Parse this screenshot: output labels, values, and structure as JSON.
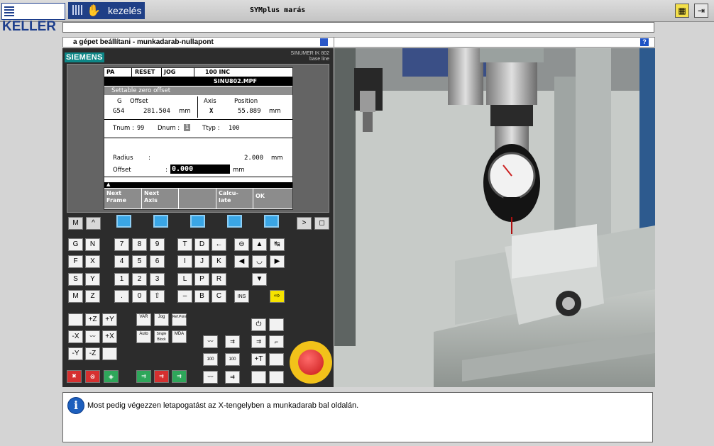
{
  "app": {
    "logo": "KELLER",
    "mode_label": "kezelés",
    "title": "SYMplus marás",
    "right_buttons": [
      "tool-icon",
      "exit-icon"
    ]
  },
  "panel_header": {
    "title": "a gépet beállítani - munkadarab-nullapont",
    "help": "?"
  },
  "controller": {
    "brand": "SIEMENS",
    "model_line1": "SINUMER IK 802",
    "model_line2": "base line",
    "status": {
      "mode": "PA",
      "reset": "RESET",
      "jog": "JOG",
      "inc": "100 INC"
    },
    "program": "SINU802.MPF",
    "section": "Settable zero offset",
    "offset": {
      "g_label": "G",
      "offset_label": "Offset",
      "g_value": "G54",
      "offset_value": "281.504",
      "offset_unit": "mm"
    },
    "axis": {
      "axis_label": "Axis",
      "position_label": "Position",
      "axis_value": "X",
      "position_value": "55.889",
      "position_unit": "mm"
    },
    "tool": {
      "tnum_label": "Tnum :",
      "tnum_value": "99",
      "dnum_label": "Dnum :",
      "dnum_value": "1",
      "ttyp_label": "Ttyp  :",
      "ttyp_value": "100"
    },
    "radius": {
      "label": "Radius",
      "colon": ":",
      "value": "2.000",
      "unit": "mm"
    },
    "offset_input": {
      "label": "Offset",
      "colon": ":",
      "value": "0.000",
      "unit": "mm"
    },
    "arrow": "▲",
    "softkeys": [
      {
        "line1": "Next",
        "line2": "Frame"
      },
      {
        "line1": "Next",
        "line2": "Axis"
      },
      {
        "line1": "",
        "line2": ""
      },
      {
        "line1": "Calcu-",
        "line2": "late"
      },
      {
        "line1": "OK",
        "line2": ""
      }
    ],
    "keys": {
      "row0": [
        "M",
        "^",
        ">",
        "◻"
      ],
      "letters": [
        [
          "G",
          "N"
        ],
        [
          "F",
          "X"
        ],
        [
          "S",
          "Y"
        ],
        [
          "M",
          "Z"
        ]
      ],
      "digits": [
        [
          "7",
          "8",
          "9"
        ],
        [
          "4",
          "5",
          "6"
        ],
        [
          "1",
          "2",
          "3"
        ],
        [
          ".",
          "0",
          "⇧"
        ]
      ],
      "letters2": [
        [
          "T",
          "D",
          "←"
        ],
        [
          "I",
          "J",
          "K"
        ],
        [
          "L",
          "P",
          "R"
        ],
        [
          "–",
          "B",
          "C"
        ]
      ],
      "nav": [
        "⊖",
        "▲",
        "↹",
        "◀",
        "◡",
        "▶",
        "▼"
      ],
      "jog": [
        "+Z",
        "+Y",
        "-X",
        "+X",
        "-Y",
        "-Z"
      ],
      "mode_keys": [
        "VAR",
        "Jog",
        "Ref.Point",
        "Auto",
        "Single Block",
        "MDA"
      ],
      "plus_t": "+T"
    }
  },
  "message": {
    "icon": "info-icon",
    "text": "Most pedig végezzen letapogatást az X-tengelyben a munkadarab bal oldalán."
  },
  "colors": {
    "brand_blue": "#1f3f86",
    "siemens_teal": "#0e8787",
    "softkey_blue": "#3aa6e6",
    "estop_red": "#c81818",
    "estop_yellow": "#f2c21a"
  }
}
